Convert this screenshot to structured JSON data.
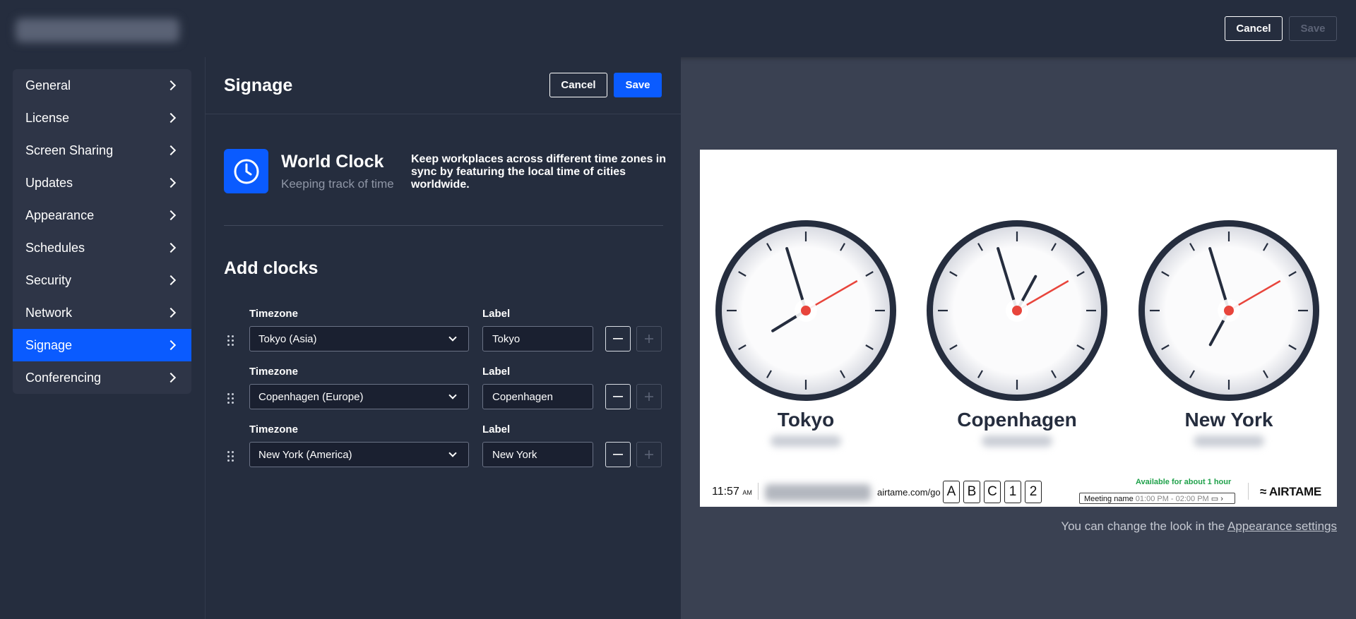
{
  "header": {
    "cancel_label": "Cancel",
    "save_label": "Save"
  },
  "sidebar": {
    "items": [
      {
        "label": "General"
      },
      {
        "label": "License"
      },
      {
        "label": "Screen Sharing"
      },
      {
        "label": "Updates"
      },
      {
        "label": "Appearance"
      },
      {
        "label": "Schedules"
      },
      {
        "label": "Security"
      },
      {
        "label": "Network"
      },
      {
        "label": "Signage",
        "active": true
      },
      {
        "label": "Conferencing"
      }
    ]
  },
  "panel": {
    "title": "Signage",
    "cancel_label": "Cancel",
    "save_label": "Save",
    "app": {
      "icon": "clock-icon",
      "title": "World Clock",
      "subtitle": "Keeping track of time",
      "description": "Keep workplaces across different time zones in sync by featuring the local time of cities worldwide."
    },
    "add_clocks_title": "Add clocks",
    "timezone_label": "Timezone",
    "label_label": "Label",
    "clocks": [
      {
        "timezone": "Tokyo (Asia)",
        "label": "Tokyo"
      },
      {
        "timezone": "Copenhagen (Europe)",
        "label": "Copenhagen"
      },
      {
        "timezone": "New York (America)",
        "label": "New York"
      }
    ]
  },
  "preview": {
    "clocks": [
      {
        "name": "Tokyo",
        "hour": 7,
        "minute": 57,
        "second": 10
      },
      {
        "name": "Copenhagen",
        "hour": 0,
        "minute": 57,
        "second": 10
      },
      {
        "name": "New York",
        "hour": 18,
        "minute": 57,
        "second": 10
      }
    ],
    "footer": {
      "time": "11:57",
      "ampm": "AM",
      "url": "airtame.com/go",
      "codes": [
        "A",
        "B",
        "C",
        "1",
        "2"
      ],
      "availability": "Available for about 1 hour",
      "meeting_name": "Meeting name",
      "meeting_time": "01:00 PM - 02:00 PM",
      "logo_text": "AIRTAME"
    },
    "accent_color": "#e8453c",
    "note_text": "You can change the look in the ",
    "note_link": "Appearance settings"
  },
  "colors": {
    "primary": "#0a5bff",
    "background": "#252d3e",
    "available": "#1fa14a"
  }
}
